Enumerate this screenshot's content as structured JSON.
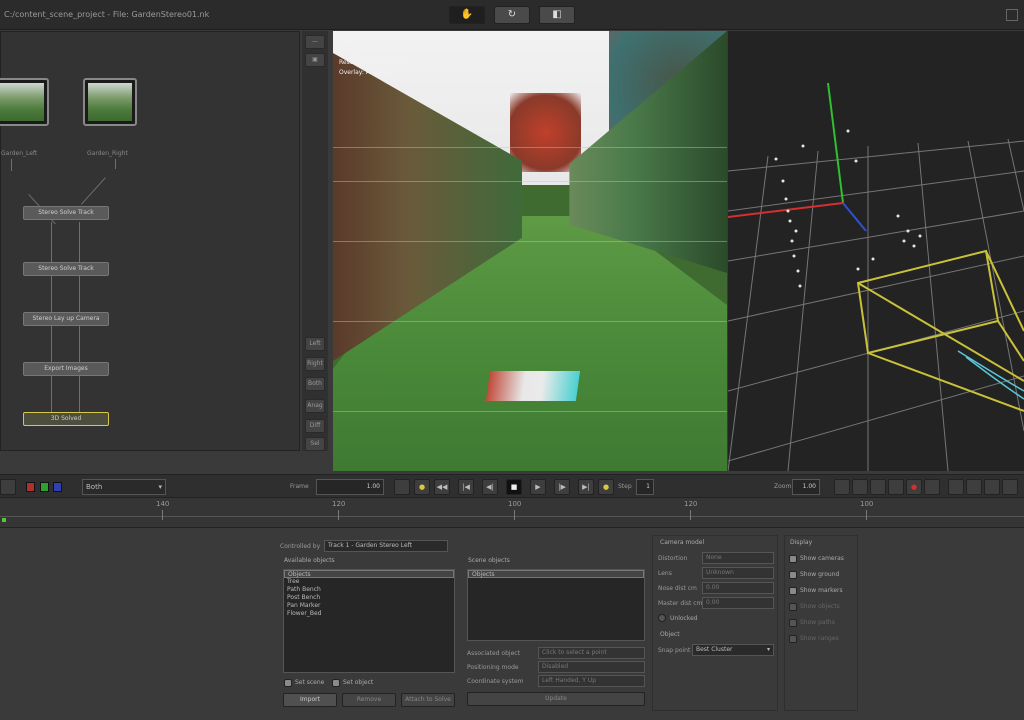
{
  "titlebar": {
    "path": "C:/content_scene_project - File: GardenStereo01.nk",
    "mode_buttons": [
      "✋",
      "↻",
      "◧"
    ]
  },
  "nodegraph": {
    "thumbs": [
      {
        "label": "Garden_Left"
      },
      {
        "label": "Garden_Right"
      }
    ],
    "nodes": [
      {
        "label": "Stereo Solve Track"
      },
      {
        "label": "Stereo Solve Track"
      },
      {
        "label": "Stereo Lay up Camera"
      },
      {
        "label": "Export Images"
      },
      {
        "label": "3D Solved"
      }
    ],
    "side_buttons": [
      "—",
      "▣",
      "Left",
      "Right",
      "Both",
      "Anag",
      "Diff",
      "Sel",
      "+"
    ]
  },
  "viewer": {
    "overlay_lines": [
      "Frame 1",
      "Camera: Stereo",
      "Resolution 1920x1080",
      "Overlay: Anaglyph"
    ]
  },
  "transport": {
    "view_select": "Both",
    "frame_label": "Frame",
    "frame_value": "1.00",
    "step_label": "Step",
    "step_value": "1",
    "zoom_label": "Zoom",
    "zoom_value": "1.00",
    "buttons": [
      "◀◀",
      "|◀",
      "◀|",
      "◀",
      "▶",
      "|▶",
      "▶|",
      "▶▶",
      "■"
    ]
  },
  "timeline": {
    "ticks": [
      "140",
      "120",
      "100",
      "120",
      "100"
    ]
  },
  "bottom": {
    "controlled_by_label": "Controlled by",
    "controlled_by_value": "Track 1 - Garden Stereo Left",
    "available_objects": {
      "title": "Available objects",
      "items": [
        "Objects",
        "Tree",
        "Path Bench",
        "Post Bench",
        "Pan Marker",
        "Flower_Bed"
      ]
    },
    "scene_objects": {
      "title": "Scene objects",
      "items": [
        "Objects"
      ]
    },
    "checks_left": [
      {
        "label": "Set scene",
        "on": true
      },
      {
        "label": "Set object",
        "on": true
      }
    ],
    "buttons": [
      "Import",
      "Remove",
      "Attach to Solve"
    ],
    "scene_fields": [
      {
        "label": "Associated object",
        "value": "Click to select a point"
      },
      {
        "label": "Positioning mode",
        "value": "Disabled"
      },
      {
        "label": "Coordinate system",
        "value": "Left Handed, Y Up"
      }
    ],
    "scene_button": "Update",
    "camera_model": {
      "title": "Camera model",
      "fields": [
        {
          "label": "Distortion",
          "value": "None"
        },
        {
          "label": "Lens",
          "value": "Unknown"
        },
        {
          "label": "Nose dist cm",
          "value": "0.00"
        },
        {
          "label": "Master dist cm",
          "value": "0.00"
        }
      ],
      "unlock_label": "Unlocked"
    },
    "object": {
      "title": "Object",
      "snap_label": "Snap point",
      "snap_value": "Best Cluster"
    },
    "display": {
      "title": "Display",
      "items": [
        {
          "label": "Show cameras",
          "on": true,
          "dim": false
        },
        {
          "label": "Show ground",
          "on": true,
          "dim": false
        },
        {
          "label": "Show markers",
          "on": true,
          "dim": false
        },
        {
          "label": "Show objects",
          "on": false,
          "dim": true
        },
        {
          "label": "Show paths",
          "on": false,
          "dim": true
        },
        {
          "label": "Show ranges",
          "on": false,
          "dim": true
        }
      ]
    }
  },
  "colors": {
    "accent_yellow": "#d8c846",
    "axis_x": "#d43030",
    "axis_y": "#30c030",
    "axis_z": "#3050d0",
    "playhead": "#5ac43a"
  }
}
